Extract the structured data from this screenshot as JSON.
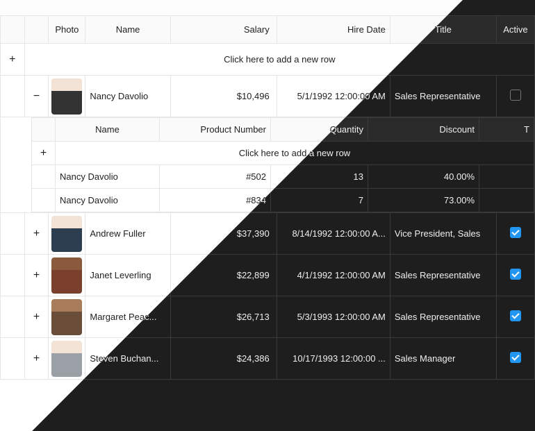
{
  "columns": {
    "photo": "Photo",
    "name": "Name",
    "salary": "Salary",
    "hire": "Hire Date",
    "title": "Title",
    "active": "Active"
  },
  "addRowText": "Click here to add a new row",
  "nestedColumns": {
    "name": "Name",
    "productNumber": "Product Number",
    "quantity": "Quantity",
    "discount": "Discount",
    "t": "T"
  },
  "rows": [
    {
      "expanded": true,
      "name": "Nancy Davolio",
      "salary": "$10,496",
      "hire": "5/1/1992 12:00:00 AM",
      "title": "Sales Representative",
      "active": false,
      "avatar": "f1",
      "nested": [
        {
          "name": "Nancy Davolio",
          "productNumber": "#502",
          "quantity": "13",
          "discount": "40.00%"
        },
        {
          "name": "Nancy Davolio",
          "productNumber": "#834",
          "quantity": "7",
          "discount": "73.00%"
        }
      ]
    },
    {
      "expanded": false,
      "name": "Andrew Fuller",
      "salary": "$37,390",
      "hire": "8/14/1992 12:00:00 A...",
      "title": "Vice President, Sales",
      "active": true,
      "avatar": "m1"
    },
    {
      "expanded": false,
      "name": "Janet Leverling",
      "salary": "$22,899",
      "hire": "4/1/1992 12:00:00 AM",
      "title": "Sales Representative",
      "active": true,
      "avatar": "f2"
    },
    {
      "expanded": false,
      "name": "Margaret  Peac...",
      "salary": "$26,713",
      "hire": "5/3/1993 12:00:00 AM",
      "title": "Sales Representative",
      "active": true,
      "avatar": "f3"
    },
    {
      "expanded": false,
      "name": "Steven  Buchan...",
      "salary": "$24,386",
      "hire": "10/17/1993 12:00:00 ...",
      "title": "Sales Manager",
      "active": true,
      "avatar": "m2"
    }
  ],
  "icons": {
    "plus": "+",
    "minus": "−"
  }
}
